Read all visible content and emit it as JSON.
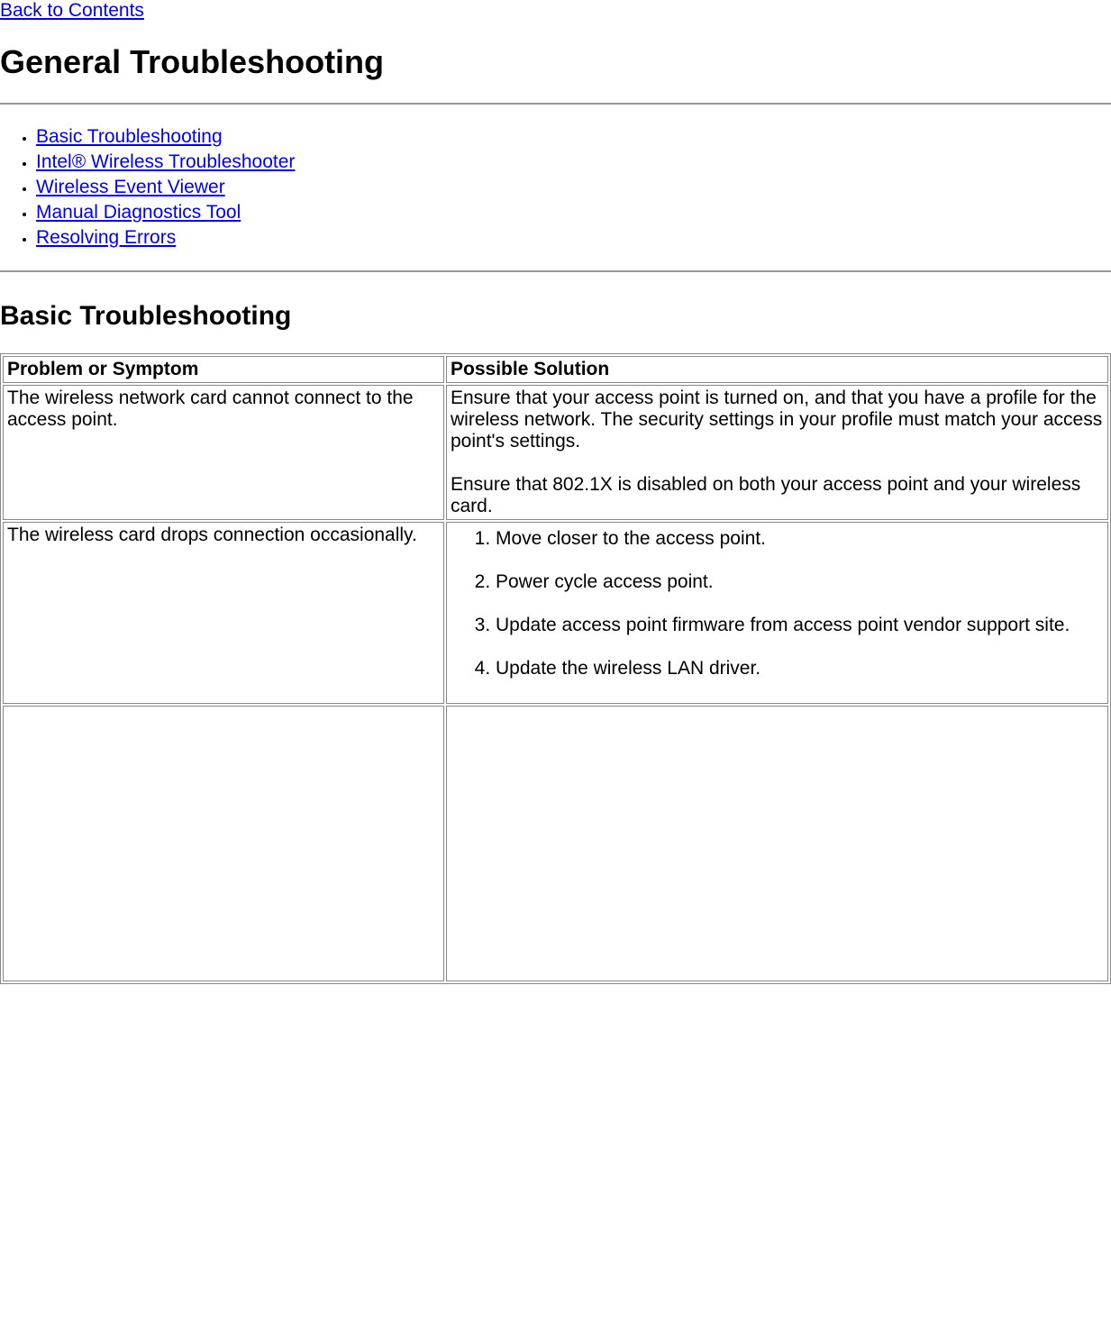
{
  "header": {
    "back_link": "Back to Contents",
    "title": "General Troubleshooting"
  },
  "nav": {
    "items": [
      "Basic Troubleshooting",
      "Intel® Wireless Troubleshooter",
      "Wireless Event Viewer",
      "Manual Diagnostics Tool",
      "Resolving Errors"
    ]
  },
  "section": {
    "heading": "Basic Troubleshooting",
    "table": {
      "headers": {
        "problem": "Problem or Symptom",
        "solution": "Possible Solution"
      },
      "rows": [
        {
          "problem": "The wireless network card cannot connect to the access point.",
          "solution_paras": [
            "Ensure that your access point is turned on, and that you have a profile for the wireless network. The security settings in your profile must match your access point's settings.",
            "Ensure that 802.1X is disabled on both your access point and your wireless card."
          ]
        },
        {
          "problem": "The wireless card drops connection occasionally.",
          "solution_steps": [
            "Move closer to the access point.",
            "Power cycle access point.",
            "Update access point firmware from access point vendor support site.",
            "Update the wireless LAN driver."
          ]
        }
      ]
    }
  }
}
